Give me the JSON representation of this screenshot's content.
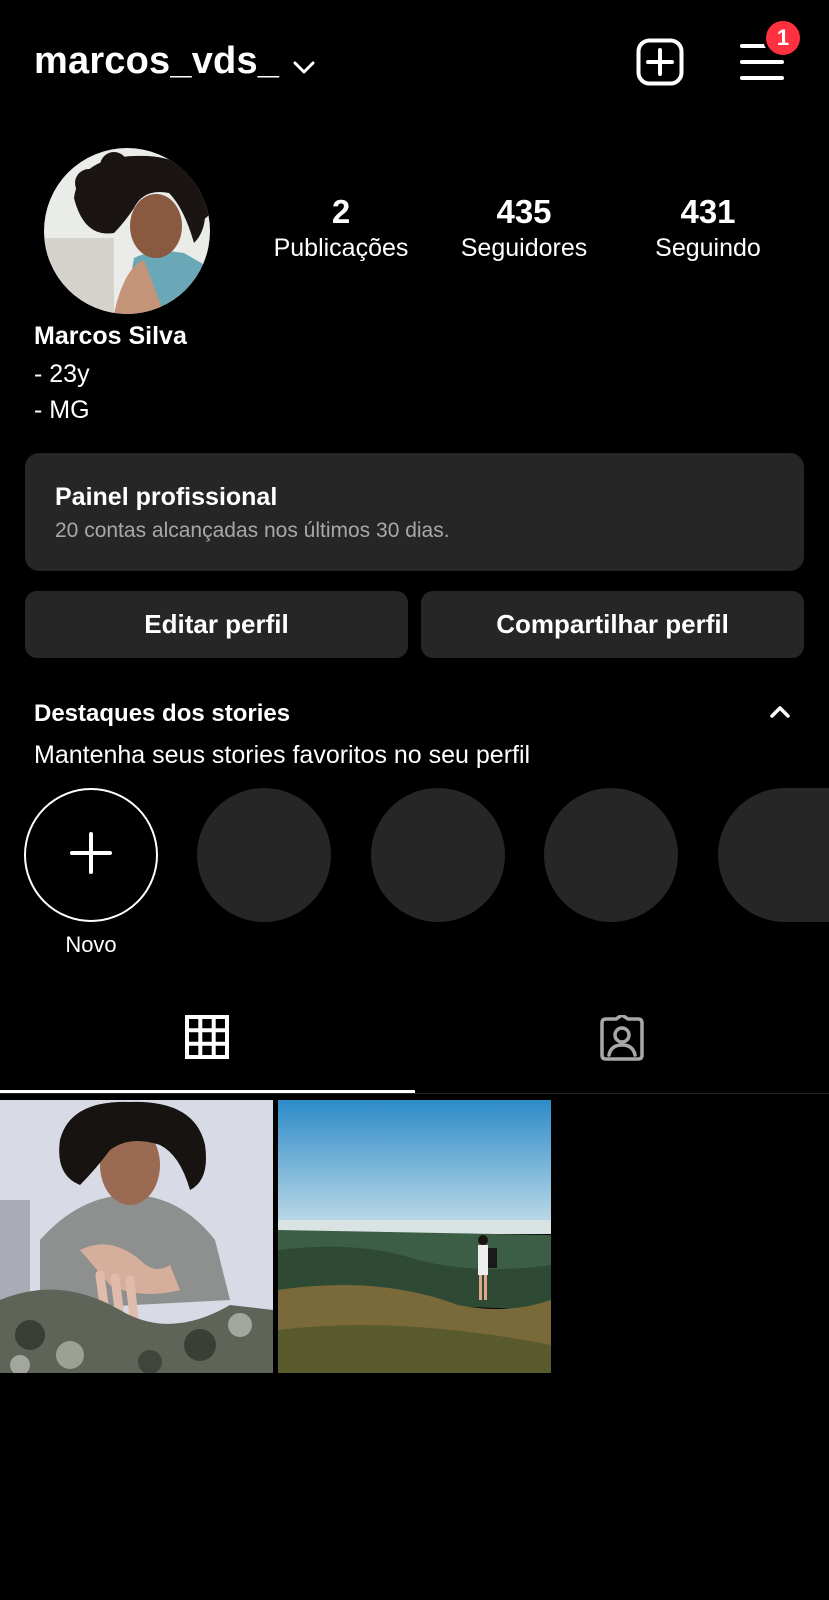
{
  "header": {
    "username": "marcos_vds_",
    "notification_count": "1"
  },
  "profile": {
    "stats": [
      {
        "value": "2",
        "label": "Publicações"
      },
      {
        "value": "435",
        "label": "Seguidores"
      },
      {
        "value": "431",
        "label": "Seguindo"
      }
    ],
    "name": "Marcos Silva",
    "bio": [
      "- 23y",
      "- MG"
    ]
  },
  "pro_panel": {
    "title": "Painel profissional",
    "subtitle": "20 contas alcançadas nos últimos 30 dias."
  },
  "buttons": {
    "edit": "Editar perfil",
    "share": "Compartilhar perfil"
  },
  "highlights": {
    "title": "Destaques dos stories",
    "subtitle": "Mantenha seus stories favoritos no seu perfil",
    "new_label": "Novo"
  },
  "tabs": {
    "active": "grid",
    "items": [
      "grid-icon",
      "tagged-icon"
    ]
  },
  "icons": {
    "dropdown": "chevron-down-icon",
    "create": "plus-square-icon",
    "menu": "hamburger-menu-icon",
    "collapse": "chevron-up-icon",
    "add": "plus-icon"
  },
  "colors": {
    "background": "#000000",
    "surface": "#262626",
    "badge": "#ff3040",
    "muted_text": "#a8a8a8"
  }
}
